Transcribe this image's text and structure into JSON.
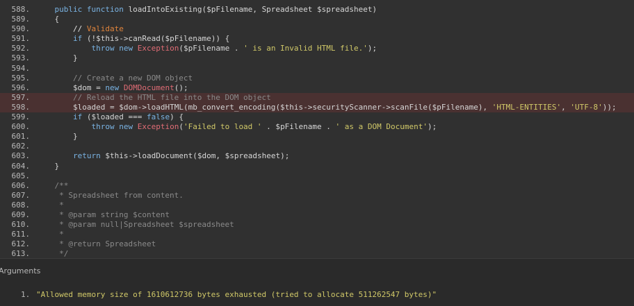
{
  "colors": {
    "background": "#303030",
    "line_number": "#b9b9b9",
    "highlight_line": "#4a3131",
    "keyword": "#7ab3e3",
    "comment": "#8a8a8a",
    "string": "#d0c868",
    "class_name": "#e06c75",
    "default": "#d6d6d6"
  },
  "code_lines": [
    {
      "number": "588.",
      "text": "    public function loadIntoExisting($pFilename, Spreadsheet $spreadsheet)"
    },
    {
      "number": "589.",
      "text": "    {"
    },
    {
      "number": "590.",
      "text": "        // Validate"
    },
    {
      "number": "591.",
      "text": "        if (!$this->canRead($pFilename)) {"
    },
    {
      "number": "592.",
      "text": "            throw new Exception($pFilename . ' is an Invalid HTML file.');"
    },
    {
      "number": "593.",
      "text": "        }"
    },
    {
      "number": "594.",
      "text": ""
    },
    {
      "number": "595.",
      "text": "        // Create a new DOM object"
    },
    {
      "number": "596.",
      "text": "        $dom = new DOMDocument();"
    },
    {
      "number": "597.",
      "text": "        // Reload the HTML file into the DOM object"
    },
    {
      "number": "598.",
      "text": "        $loaded = $dom->loadHTML(mb_convert_encoding($this->securityScanner->scanFile($pFilename), 'HTML-ENTITIES', 'UTF-8'));"
    },
    {
      "number": "599.",
      "text": "        if ($loaded === false) {"
    },
    {
      "number": "600.",
      "text": "            throw new Exception('Failed to load ' . $pFilename . ' as a DOM Document');"
    },
    {
      "number": "601.",
      "text": "        }"
    },
    {
      "number": "602.",
      "text": ""
    },
    {
      "number": "603.",
      "text": "        return $this->loadDocument($dom, $spreadsheet);"
    },
    {
      "number": "604.",
      "text": "    }"
    },
    {
      "number": "605.",
      "text": ""
    },
    {
      "number": "606.",
      "text": "    /**"
    },
    {
      "number": "607.",
      "text": "     * Spreadsheet from content."
    },
    {
      "number": "608.",
      "text": "     *"
    },
    {
      "number": "609.",
      "text": "     * @param string $content"
    },
    {
      "number": "610.",
      "text": "     * @param null|Spreadsheet $spreadsheet"
    },
    {
      "number": "611.",
      "text": "     *"
    },
    {
      "number": "612.",
      "text": "     * @return Spreadsheet"
    },
    {
      "number": "613.",
      "text": "     */"
    }
  ],
  "highlighted_lines": [
    "597.",
    "598."
  ],
  "arguments": {
    "header": "Arguments",
    "items": [
      {
        "index": "1.",
        "value": "\"Allowed memory size of 1610612736 bytes exhausted (tried to allocate 511262547 bytes)\""
      }
    ]
  }
}
